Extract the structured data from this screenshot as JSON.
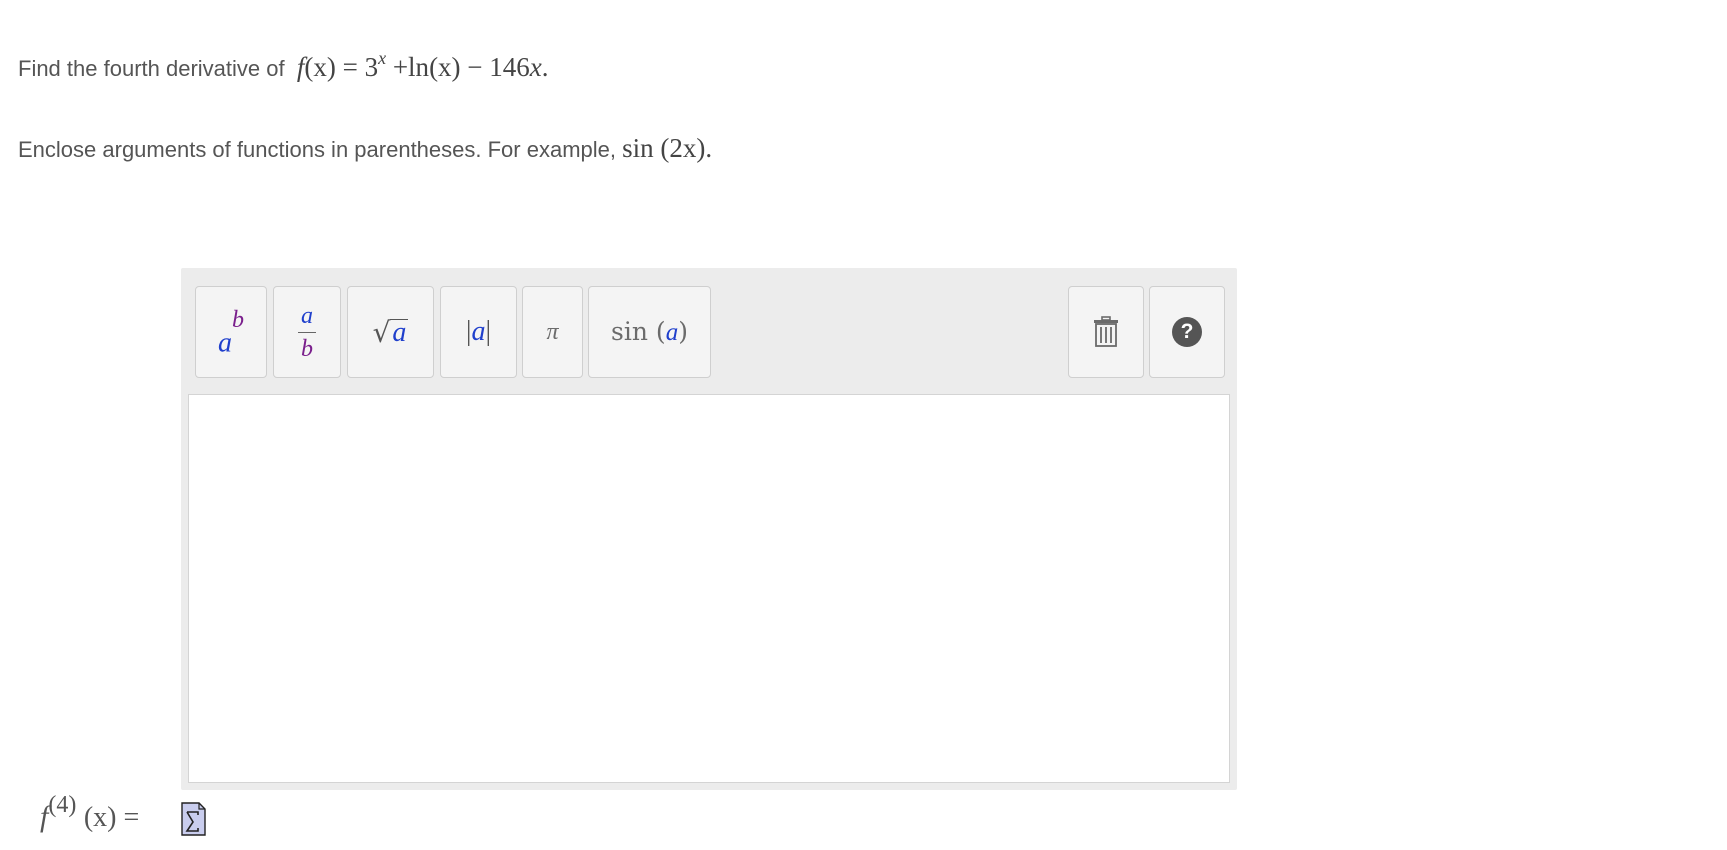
{
  "question": {
    "prompt_text": "Find the fourth derivative of",
    "expression": {
      "func_name": "f",
      "func_arg": "(x)",
      "equals": "=",
      "base": "3",
      "exponent": "x",
      "plus": "+",
      "ln_name": "ln",
      "ln_arg": "(x)",
      "minus": "−",
      "coefficient": "146",
      "variable": "x",
      "period": "."
    },
    "instruction_text": "Enclose arguments of functions in parentheses. For example,",
    "example": {
      "fn": "sin",
      "arg": "(2x)",
      "period": "."
    }
  },
  "toolbar": {
    "power": {
      "base": "a",
      "exp": "b"
    },
    "fraction": {
      "num": "a",
      "den": "b"
    },
    "sqrt": {
      "radical": "√",
      "arg": "a"
    },
    "abs": {
      "left": "|",
      "arg": "a",
      "right": "|"
    },
    "pi": {
      "symbol": "π"
    },
    "sin": {
      "fn": "sin",
      "open": "(",
      "arg": "a",
      "close": ")"
    },
    "help": {
      "symbol": "?"
    }
  },
  "editor": {
    "value": ""
  },
  "answer": {
    "f": "f",
    "order": "(4)",
    "arg": "(x)",
    "equals": "="
  },
  "colors": {
    "variable_blue": "#1f3fcc",
    "variable_purple": "#7a1f8c",
    "panel_bg": "#ececec",
    "button_bg": "#f4f4f4",
    "help_circle": "#555555"
  }
}
